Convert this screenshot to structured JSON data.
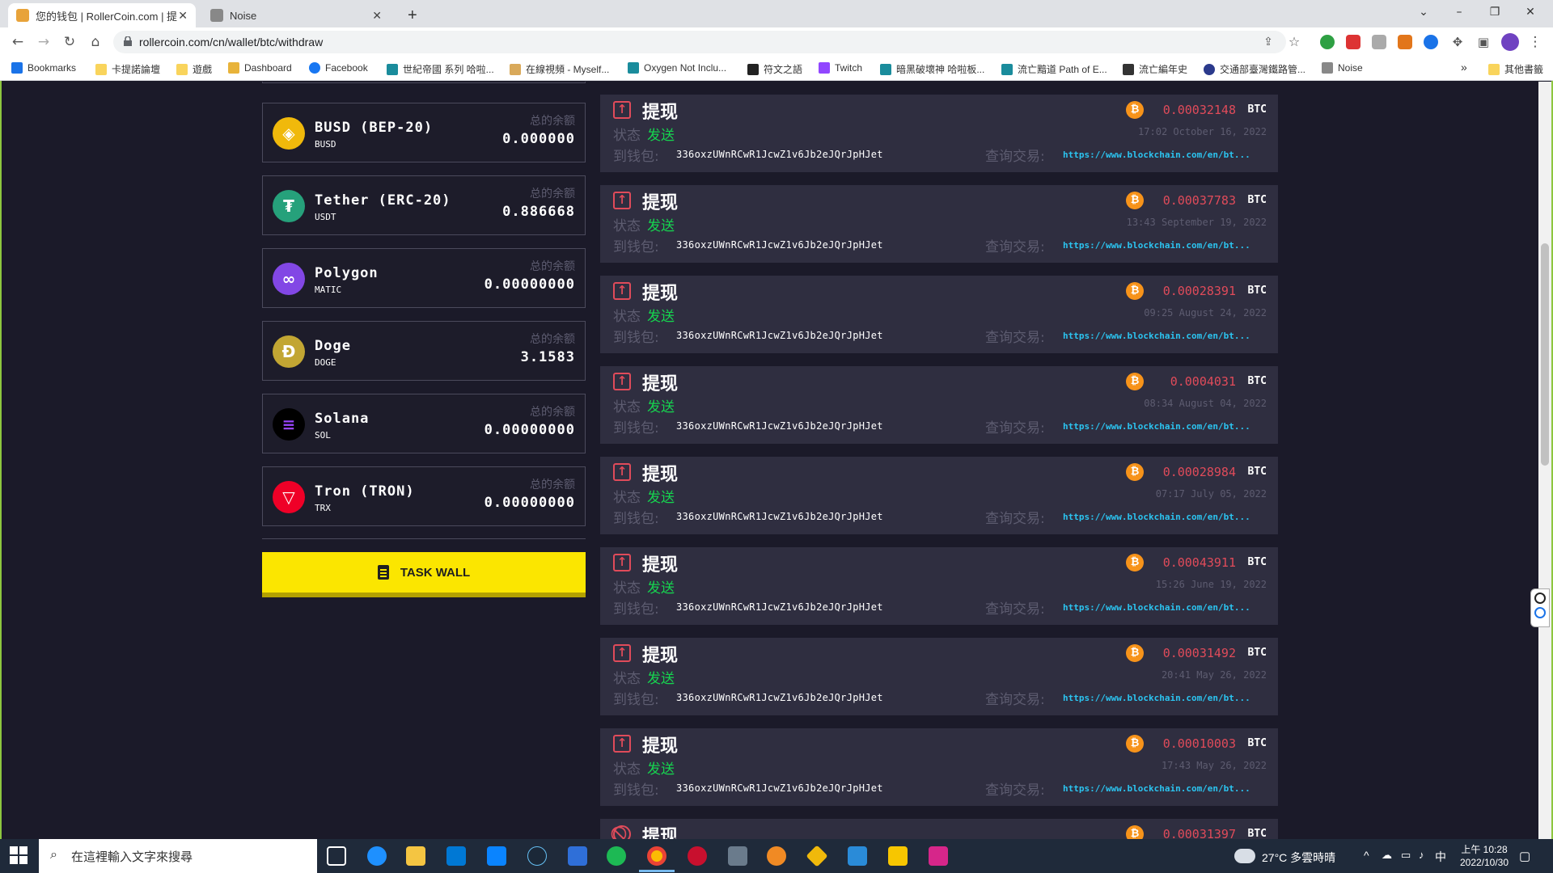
{
  "browser": {
    "tabs": [
      {
        "title": "您的钱包 | RollerCoin.com | 提现",
        "active": true
      },
      {
        "title": "Noise",
        "active": false
      }
    ],
    "new_tab": "+",
    "url": "rollercoin.com/cn/wallet/btc/withdraw",
    "bookmarks": [
      "Bookmarks",
      "卡提諾論壇",
      "遊戲",
      "Dashboard",
      "Facebook",
      "世紀帝國 系列 哈啦...",
      "在線視頻 - Myself...",
      "Oxygen Not Inclu...",
      "符文之語",
      "Twitch",
      "暗黑破壞神 哈啦板...",
      "流亡黯道 Path of E...",
      "流亡編年史",
      "交通部臺灣鐵路管...",
      "Noise"
    ],
    "more_bookmarks": "»",
    "other_bookmarks": "其他書籤"
  },
  "wallet": {
    "balance_label": "总的余额",
    "coins": [
      {
        "name": "BUSD (BEP-20)",
        "ticker": "BUSD",
        "balance": "0.000000",
        "icon_color": "#f0b90b",
        "icon": "busd-icon"
      },
      {
        "name": "Tether (ERC-20)",
        "ticker": "USDT",
        "balance": "0.886668",
        "icon_color": "#26a17b",
        "icon": "tether-icon"
      },
      {
        "name": "Polygon",
        "ticker": "MATIC",
        "balance": "0.00000000",
        "icon_color": "#8247e5",
        "icon": "polygon-icon"
      },
      {
        "name": "Doge",
        "ticker": "DOGE",
        "balance": "3.1583",
        "icon_color": "#c2a633",
        "icon": "doge-icon"
      },
      {
        "name": "Solana",
        "ticker": "SOL",
        "balance": "0.00000000",
        "icon_color": "#000000",
        "icon": "solana-icon"
      },
      {
        "name": "Tron (TRON)",
        "ticker": "TRX",
        "balance": "0.00000000",
        "icon_color": "#ef0027",
        "icon": "tron-icon"
      }
    ],
    "task_wall": "TASK WALL"
  },
  "withdrawals": {
    "title": "提现",
    "status_label": "状态",
    "wallet_label": "到钱包:",
    "query_label": "查询交易:",
    "currency": "BTC",
    "address": "336oxzUWnRCwR1JcwZ1v6Jb2eJQrJpHJet",
    "link": "https://www.blockchain.com/en/bt...",
    "items": [
      {
        "amount": "0.00032148",
        "date": "17:02 October 16, 2022",
        "status": "发送"
      },
      {
        "amount": "0.00037783",
        "date": "13:43 September 19, 2022",
        "status": "发送"
      },
      {
        "amount": "0.00028391",
        "date": "09:25 August 24, 2022",
        "status": "发送"
      },
      {
        "amount": "0.0004031",
        "date": "08:34 August 04, 2022",
        "status": "发送"
      },
      {
        "amount": "0.00028984",
        "date": "07:17 July 05, 2022",
        "status": "发送"
      },
      {
        "amount": "0.00043911",
        "date": "15:26 June 19, 2022",
        "status": "发送"
      },
      {
        "amount": "0.00031492",
        "date": "20:41 May 26, 2022",
        "status": "发送"
      },
      {
        "amount": "0.00010003",
        "date": "17:43 May 26, 2022",
        "status": "发送"
      },
      {
        "amount": "0.00031397",
        "date": "",
        "status": ""
      }
    ]
  },
  "taskbar": {
    "search_placeholder": "在這裡輸入文字來搜尋",
    "weather": "27°C 多雲時晴",
    "ime": "中",
    "time": "上午 10:28",
    "date": "2022/10/30"
  }
}
